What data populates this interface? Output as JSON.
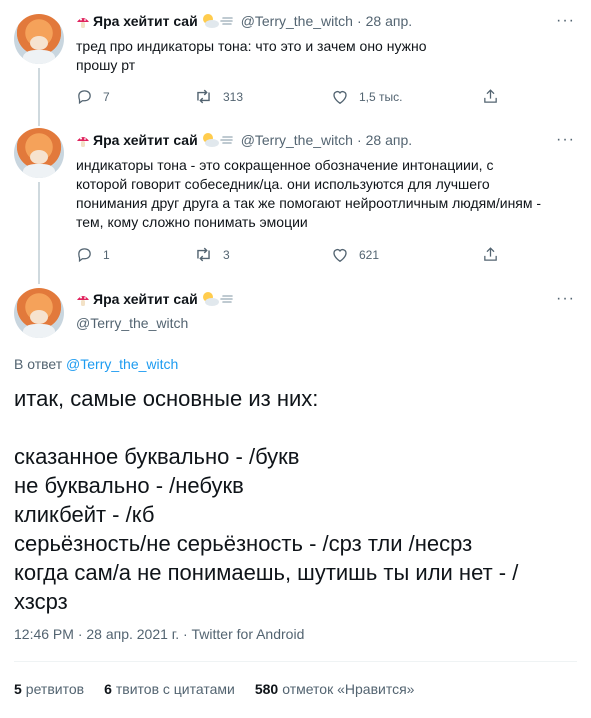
{
  "tweets": [
    {
      "name": "Яра хейтит сай",
      "handle": "@Terry_the_witch",
      "date": "28 апр.",
      "text": "тред про индикаторы тона: что это и зачем оно нужно\nпрошу рт",
      "replies": "7",
      "retweets": "313",
      "likes": "1,5 тыс."
    },
    {
      "name": "Яра хейтит сай",
      "handle": "@Terry_the_witch",
      "date": "28 апр.",
      "text": "индикаторы тона - это сокращенное обозначение интонациии, с\nкоторой говорит собеседник/ца. они используются для лучшего\nпонимания друг друга а так же помогают нейроотличным людям/иням -\nтем, кому сложно понимать эмоции",
      "replies": "1",
      "retweets": "3",
      "likes": "621"
    }
  ],
  "main": {
    "name": "Яра хейтит сай",
    "handle": "@Terry_the_witch",
    "reply_prefix": "В ответ ",
    "reply_handle": "@Terry_the_witch",
    "lines": [
      "итак, самые основные из них:",
      "",
      "сказанное буквально - /букв",
      "не буквально - /небукв",
      "кликбейт - /кб",
      "серьёзность/не серьёзность - /срз тли /несрз",
      "когда сам/а не понимаешь, шутишь ты или нет - /",
      "хзсрз"
    ],
    "meta": "12:46 PM · 28 апр. 2021 г. · Twitter for Android",
    "stats": {
      "retweets_count": "5",
      "retweets_label": "ретвитов",
      "quotes_count": "6",
      "quotes_label": "твитов с цитатами",
      "likes_count": "580",
      "likes_label": "отметок «Нравится»"
    }
  },
  "ui": {
    "more": "···",
    "dot": "·"
  },
  "colors": {
    "accent": "#1d9bf0",
    "muted": "#536471",
    "text": "#0f1419"
  }
}
